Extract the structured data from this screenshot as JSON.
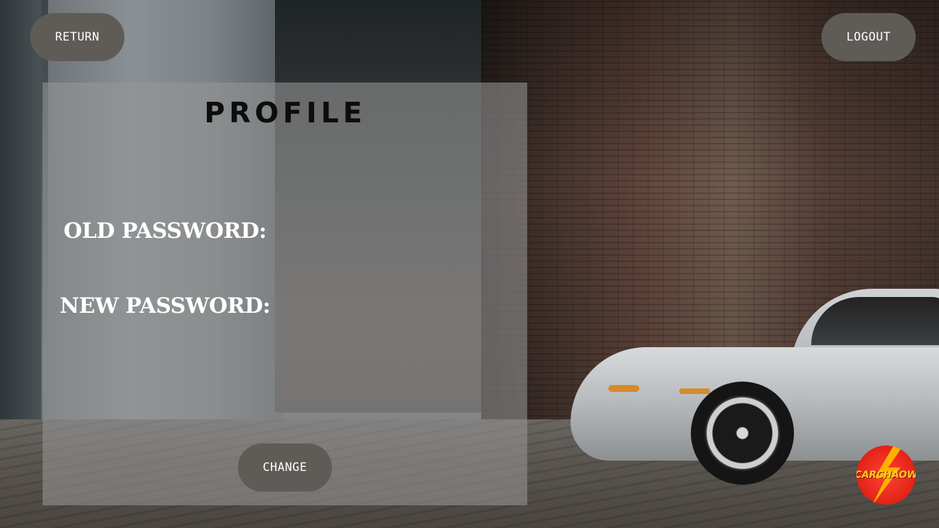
{
  "header": {
    "return_label": "RETURN",
    "logout_label": "LOGOUT"
  },
  "profile": {
    "title": "PROFILE",
    "old_password_label": "OLD PASSWORD:",
    "new_password_label": "NEW PASSWORD:",
    "change_label": "CHANGE"
  },
  "brand": {
    "logo_text": "CARCHAOW",
    "logo_icon": "lightning-bolt-icon"
  },
  "colors": {
    "button_bg": "#5f5c57",
    "panel_overlay": "rgba(150,150,150,0.58)",
    "logo_red": "#e22216",
    "logo_yellow": "#ffcc22"
  }
}
